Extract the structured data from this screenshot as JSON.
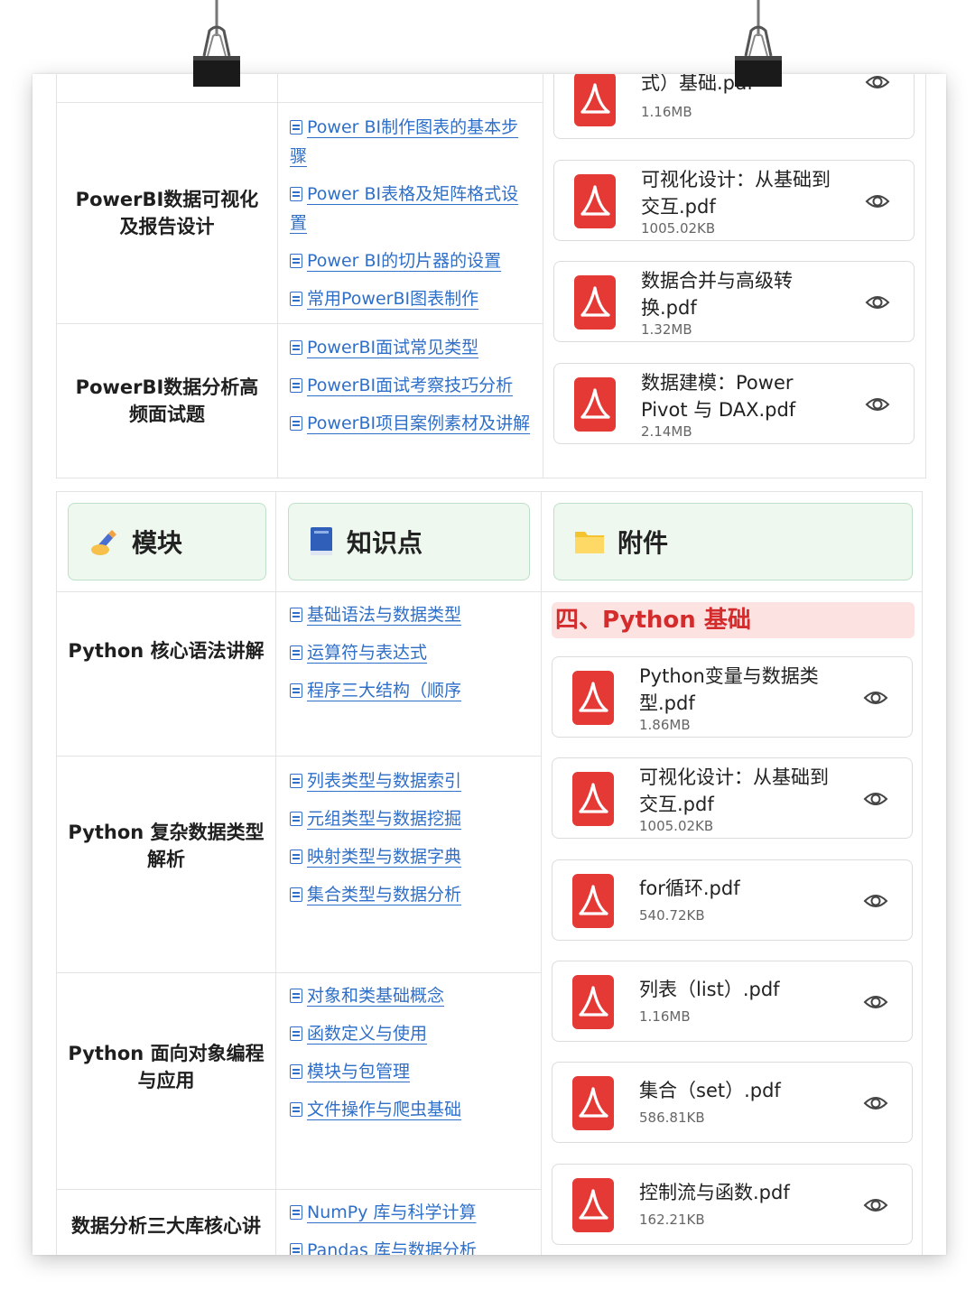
{
  "upper": {
    "rows": [
      {
        "module": "PowerBI数据可视化及报告设计",
        "knowledge": [
          "Power BI制作图表的基本步骤",
          "Power BI表格及矩阵格式设置",
          "Power BI的切片器的设置",
          "常用PowerBI图表制作"
        ]
      },
      {
        "module": "PowerBI数据分析高频面试题",
        "knowledge": [
          "PowerBI面试常见类型",
          "PowerBI面试考察技巧分析",
          "PowerBI项目案例素材及讲解"
        ]
      }
    ],
    "files": [
      {
        "name": "式）基础.pdf",
        "size": "1.16MB"
      },
      {
        "name": "可视化设计：从基础到交互.pdf",
        "size": "1005.02KB"
      },
      {
        "name": "数据合并与高级转换.pdf",
        "size": "1.32MB"
      },
      {
        "name": "数据建模：Power Pivot 与 DAX.pdf",
        "size": "2.14MB"
      }
    ]
  },
  "lower": {
    "headers": {
      "module": "模块",
      "knowledge": "知识点",
      "attachment": "附件"
    },
    "header_icons": {
      "module": "writing-hand-icon",
      "knowledge": "blue-book-icon",
      "attachment": "folder-icon"
    },
    "section_title": "四、Python 基础",
    "rows": [
      {
        "module": "Python 核心语法讲解",
        "knowledge": [
          "基础语法与数据类型",
          "运算符与表达式",
          "程序三大结构（顺序"
        ]
      },
      {
        "module": "Python 复杂数据类型解析",
        "knowledge": [
          "列表类型与数据索引",
          "元组类型与数据挖掘",
          "映射类型与数据字典",
          "集合类型与数据分析"
        ]
      },
      {
        "module": "Python 面向对象编程与应用",
        "knowledge": [
          "对象和类基础概念",
          "函数定义与使用",
          "模块与包管理",
          "文件操作与爬虫基础"
        ]
      },
      {
        "module": "数据分析三大库核心讲",
        "knowledge": [
          "NumPy 库与科学计算",
          "Pandas 库与数据分析"
        ]
      }
    ],
    "files": [
      {
        "name": "Python变量与数据类型.pdf",
        "size": "1.86MB"
      },
      {
        "name": "可视化设计：从基础到交互.pdf",
        "size": "1005.02KB"
      },
      {
        "name": "for循环.pdf",
        "size": "540.72KB"
      },
      {
        "name": "列表（list）.pdf",
        "size": "1.16MB"
      },
      {
        "name": "集合（set）.pdf",
        "size": "586.81KB"
      },
      {
        "name": "控制流与函数.pdf",
        "size": "162.21KB"
      }
    ]
  },
  "colors": {
    "link": "#2f6fc8",
    "pdf_red": "#e53935",
    "section_bg": "#fde2e2",
    "section_text": "#d42c2c",
    "header_bg": "#eef8ee"
  }
}
